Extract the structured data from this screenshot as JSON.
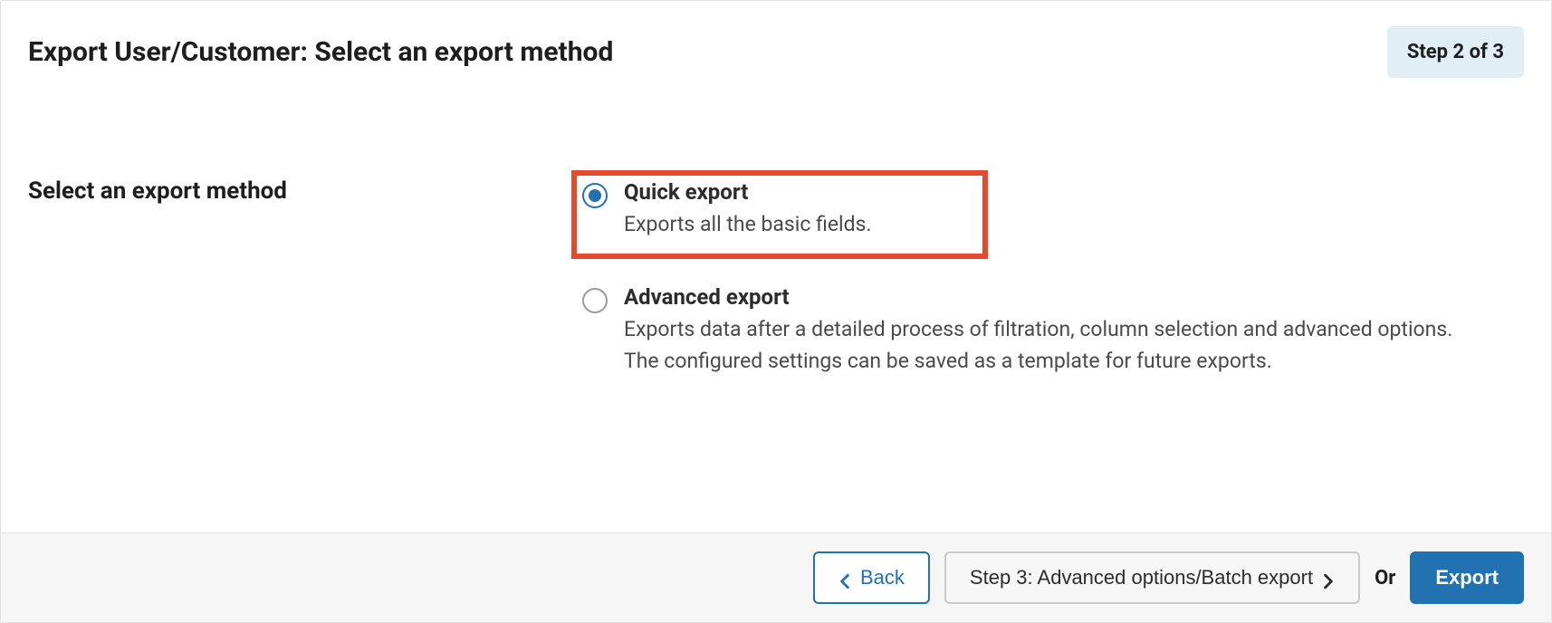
{
  "header": {
    "title": "Export User/Customer: Select an export method",
    "step_badge": "Step 2 of 3"
  },
  "section": {
    "label": "Select an export method"
  },
  "options": {
    "quick": {
      "title": "Quick export",
      "desc": "Exports all the basic fields.",
      "selected": true,
      "highlighted": true
    },
    "advanced": {
      "title": "Advanced export",
      "desc": "Exports data after a detailed process of filtration, column selection and advanced options. The configured settings can be saved as a template for future exports.",
      "selected": false,
      "highlighted": false
    }
  },
  "footer": {
    "back_label": "Back",
    "next_label": "Step 3: Advanced options/Batch export",
    "or_label": "Or",
    "export_label": "Export"
  }
}
